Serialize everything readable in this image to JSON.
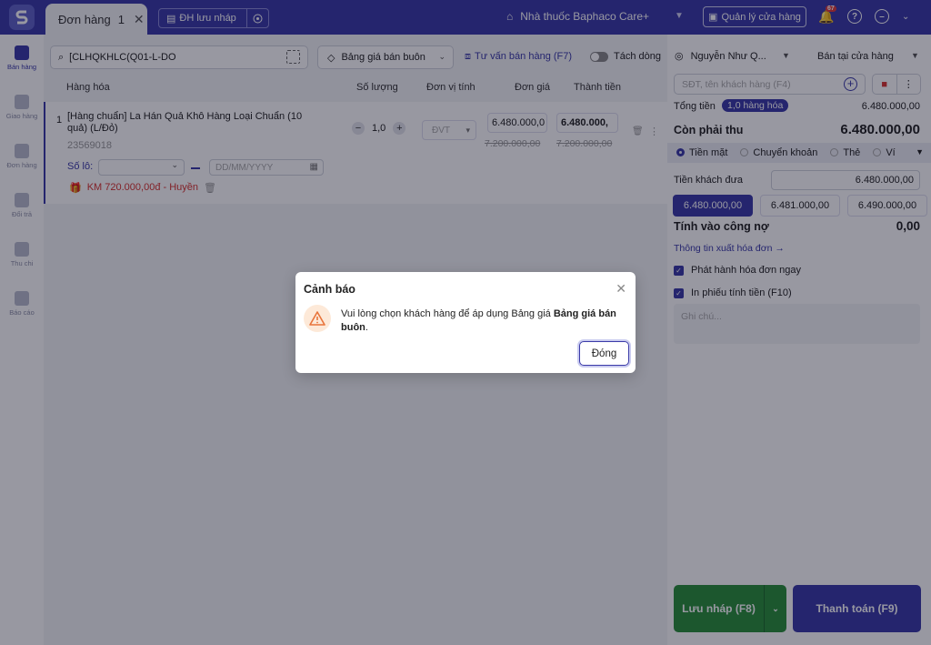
{
  "topbar": {
    "tab_label": "Đơn hàng",
    "tab_number": "1",
    "tab_close": "✕",
    "draft_tab_label": "ĐH lưu nháp",
    "store_name": "Nhà thuốc Baphaco Care+",
    "manage_store_label": "Quản lý cửa hàng",
    "notification_count": "67"
  },
  "sidebar": {
    "items": [
      {
        "label": "Bán hàng"
      },
      {
        "label": "Giao hàng"
      },
      {
        "label": "Đơn hàng"
      },
      {
        "label": "Đổi trả"
      },
      {
        "label": "Thu chi"
      },
      {
        "label": "Báo cáo"
      }
    ]
  },
  "main": {
    "search_value": "[CLHQKHLC(Q01-L-DO",
    "pricebook": "Bảng giá bán buôn",
    "advise_label": "Tư vấn bán hàng (F7)",
    "split_label": "Tách dòng",
    "columns": {
      "product": "Hàng hóa",
      "qty": "Số lượng",
      "unit": "Đơn vị tính",
      "price": "Đơn giá",
      "total": "Thành tiền"
    },
    "row": {
      "index": "1",
      "name": "[Hàng chuẩn] La Hán Quả Khô Hàng Loại Chuẩn (10 quả) (L/Đỏ)",
      "sku": "23569018",
      "qty": "1,0",
      "unit_placeholder": "ĐVT",
      "price": "6.480.000,0",
      "total": "6.480.000,",
      "old_price": "7.200.000,00",
      "old_total": "7.200.000,00",
      "lot_label": "Số lô:",
      "date_placeholder": "DD/MM/YYYY",
      "promo": "KM 720.000,00đ - Huyền"
    }
  },
  "right": {
    "customer": "Nguyễn Như Q...",
    "sale_mode": "Bán tại cửa hàng",
    "phone_placeholder": "SĐT, tên khách hàng (F4)",
    "total_label": "Tổng tiền",
    "total_badge": "1,0 hàng hóa",
    "total_value": "6.480.000,00",
    "remain_label": "Còn phải thu",
    "remain_value": "6.480.000,00",
    "methods": [
      "Tiền mặt",
      "Chuyển khoản",
      "Thẻ",
      "Ví"
    ],
    "given_label": "Tiền khách đưa",
    "given_value": "6.480.000,00",
    "quick_amounts": [
      "6.480.000,00",
      "6.481.000,00",
      "6.490.000,00"
    ],
    "debt_label": "Tính vào công nợ",
    "debt_value": "0,00",
    "invoice_link": "Thông tin xuất hóa đơn →",
    "issue_invoice": "Phát hành hóa đơn ngay",
    "print_receipt": "In phiếu tính tiền (F10)",
    "note_placeholder": "Ghi chú...",
    "save_draft": "Lưu nháp (F8)",
    "pay": "Thanh toán (F9)"
  },
  "modal": {
    "title": "Cảnh báo",
    "text_prefix": "Vui lòng chọn khách hàng để áp dụng Bảng giá ",
    "text_bold": "Bảng giá bán buôn",
    "text_suffix": ".",
    "close_button": "Đóng"
  },
  "colors": {
    "primary": "#3a3aa8",
    "green": "#2a8f3a",
    "danger": "#d9332f"
  }
}
